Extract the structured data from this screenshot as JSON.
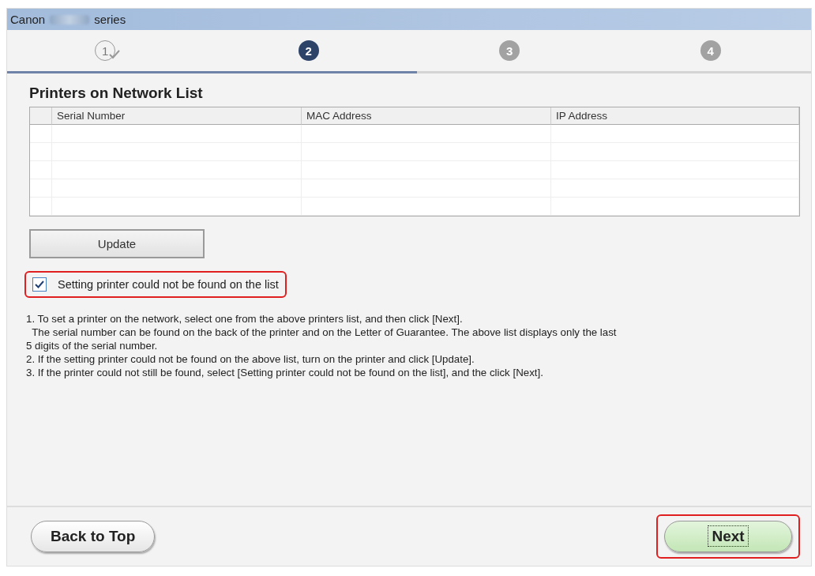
{
  "window": {
    "title_start": "Canon",
    "title_end": "series",
    "title_redacted": true
  },
  "steps": [
    {
      "label": "1",
      "completed": true,
      "selected": false
    },
    {
      "label": "2",
      "completed": false,
      "selected": true
    },
    {
      "label": "3",
      "completed": false,
      "selected": false
    },
    {
      "label": "4",
      "completed": false,
      "selected": false
    }
  ],
  "progress": {
    "level": 0.51
  },
  "heading": "Printers on Network List",
  "table": {
    "columns": [
      "Serial Number",
      "MAC Address",
      "IP Address"
    ],
    "rows": [
      {
        "selected": false
      },
      {
        "selected": false
      },
      {
        "selected": false
      },
      {
        "selected": false
      },
      {
        "selected": false
      }
    ]
  },
  "update_button": "Update",
  "not_found_checkbox": {
    "label": "Setting printer could not be found on the list",
    "checked": true,
    "highlighted": true
  },
  "instructions": [
    "1. To set a printer on the network, select one from the above printers list, and then click [Next].",
    "  The serial number can be found on the back of the printer and on the Letter of Guarantee. The above list displays only the last",
    "5 digits of the serial number.",
    "2. If the setting printer could not be found on the above list, turn on the printer and click [Update].",
    "3. If the printer could not still be found, select [Setting printer could not be found on the list], and the click [Next]."
  ],
  "back_button": "Back to Top",
  "next_button": {
    "label": "Next",
    "highlighted": true
  }
}
